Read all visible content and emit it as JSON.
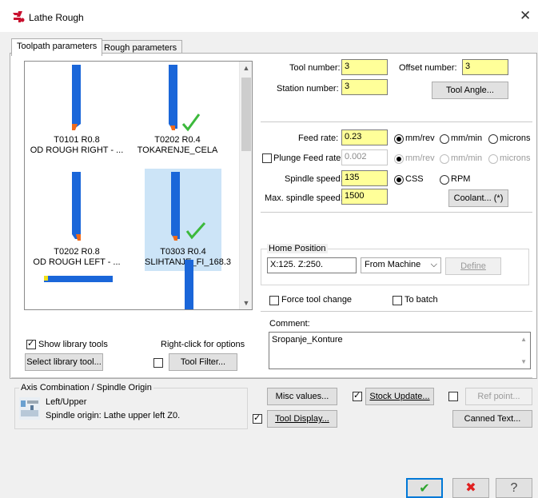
{
  "window": {
    "title": "Lathe Rough",
    "close_label": "✕"
  },
  "tabs": [
    {
      "label": "Toolpath parameters",
      "active": true
    },
    {
      "label": "Rough parameters",
      "active": false
    }
  ],
  "tools": [
    {
      "line1": "T0101 R0.8",
      "line2": "OD ROUGH RIGHT - ...",
      "check": false
    },
    {
      "line1": "T0202 R0.4",
      "line2": "TOKARENJE_CELA",
      "check": true
    },
    {
      "line1": "T0202 R0.8",
      "line2": "OD ROUGH LEFT - ...",
      "check": false
    },
    {
      "line1": "T0303 R0.4",
      "line2": "SLIHTANJE_FI_168.3",
      "check": true,
      "selected": true
    }
  ],
  "tool_list_controls": {
    "show_library_label": "Show library tools",
    "show_library_checked": true,
    "right_click_label": "Right-click for options",
    "select_library_button": "Select library tool...",
    "tool_filter_button": "Tool Filter...",
    "tool_filter_checked": false
  },
  "tool_info": {
    "tool_number_label": "Tool number:",
    "tool_number": "3",
    "offset_number_label": "Offset number:",
    "offset_number": "3",
    "station_number_label": "Station number:",
    "station_number": "3",
    "tool_angle_button": "Tool Angle..."
  },
  "feeds": {
    "feed_rate_label": "Feed rate:",
    "feed_rate": "0.23",
    "feed_units": [
      "mm/rev",
      "mm/min",
      "microns"
    ],
    "feed_unit_selected": "mm/rev",
    "plunge_label": "Plunge Feed rate:",
    "plunge_value": "0.002",
    "plunge_checked": false,
    "spindle_speed_label": "Spindle speed:",
    "spindle_speed": "135",
    "spindle_modes": [
      "CSS",
      "RPM"
    ],
    "spindle_mode_selected": "CSS",
    "max_spindle_label": "Max. spindle speed:",
    "max_spindle": "1500",
    "coolant_button": "Coolant... (*)"
  },
  "home_position": {
    "group_label": "Home Position",
    "value": "X:125.  Z:250.",
    "mode": "From Machine",
    "define_button": "Define"
  },
  "options": {
    "force_tool_change": "Force tool change",
    "to_batch": "To batch"
  },
  "comment": {
    "label": "Comment:",
    "text": "Sropanje_Konture"
  },
  "axis_combo": {
    "group_label": "Axis Combination / Spindle Origin",
    "line1": "Left/Upper",
    "line2": "Spindle origin: Lathe upper left  Z0."
  },
  "bottom_buttons": {
    "misc_values": "Misc values...",
    "stock_update": "Stock Update...",
    "stock_update_checked": true,
    "ref_point": "Ref point...",
    "ref_point_checked": false,
    "tool_display": "Tool Display...",
    "tool_display_checked": true,
    "canned_text": "Canned Text..."
  },
  "dialog_buttons": {
    "ok": "✔",
    "cancel": "✖",
    "help": "?"
  },
  "colors": {
    "highlight_input": "#ffff99",
    "tool_body": "#1a66d9",
    "tool_insert": "#f06a1a",
    "selected_bg": "#cce4f7",
    "check_green": "#3cb93c",
    "ok_green": "#2ea52e",
    "cancel_red": "#e02020"
  }
}
